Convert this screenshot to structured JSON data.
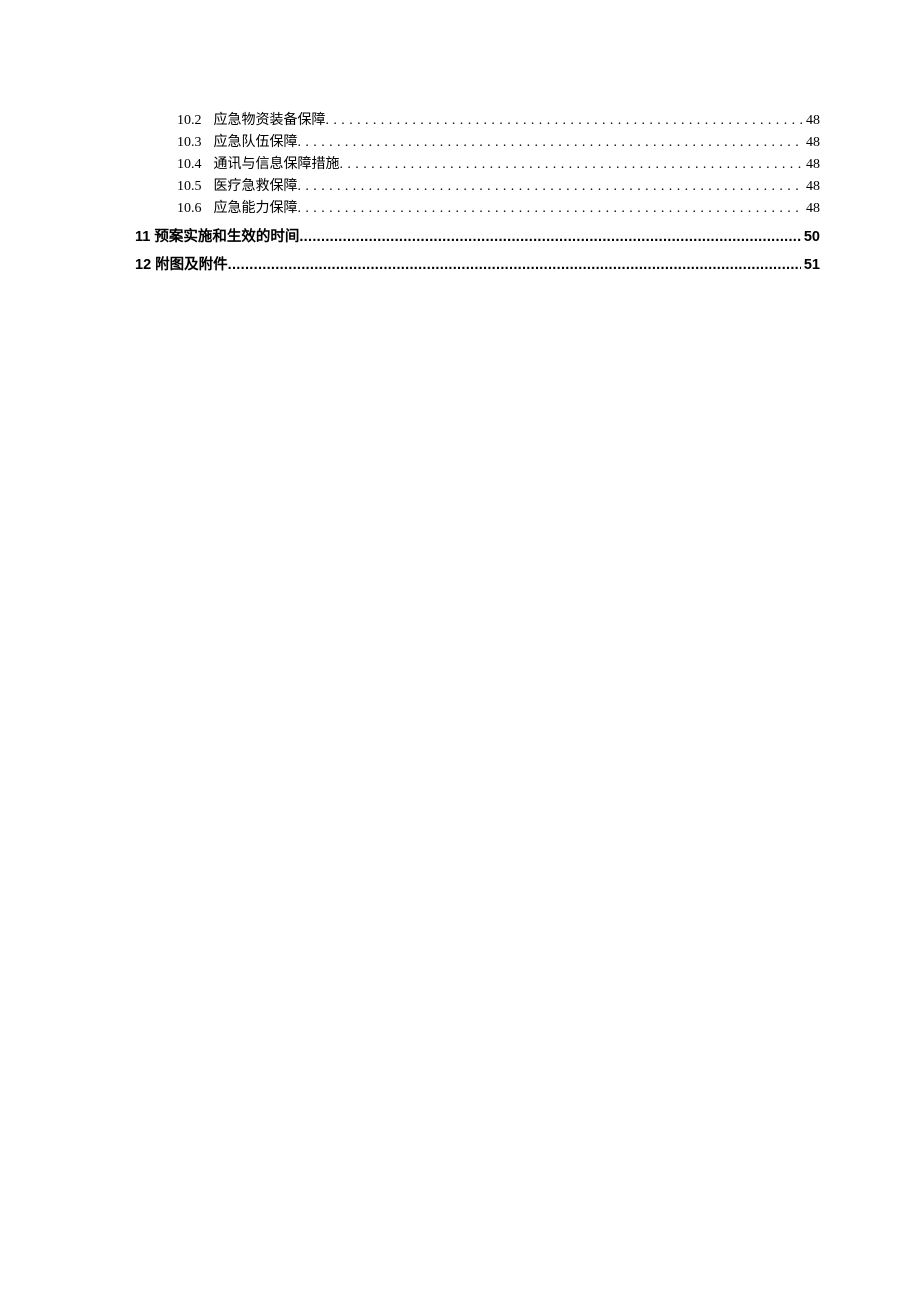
{
  "toc": {
    "sub_items": [
      {
        "number": "10.2",
        "title": "应急物资装备保障",
        "page": "48"
      },
      {
        "number": "10.3",
        "title": "应急队伍保障",
        "page": "48"
      },
      {
        "number": "10.4",
        "title": "通讯与信息保障措施",
        "page": "48"
      },
      {
        "number": "10.5",
        "title": "医疗急救保障",
        "page": "48"
      },
      {
        "number": "10.6",
        "title": "应急能力保障",
        "page": "48"
      }
    ],
    "main_items": [
      {
        "number": "11",
        "title": "预案实施和生效的时间",
        "page": "50"
      },
      {
        "number": "12",
        "title": "附图及附件",
        "page": "51"
      }
    ]
  },
  "leader_sparse": "..............................................................................................",
  "leader_dense": "......................................................................................................................................................................................................................................................................................................"
}
